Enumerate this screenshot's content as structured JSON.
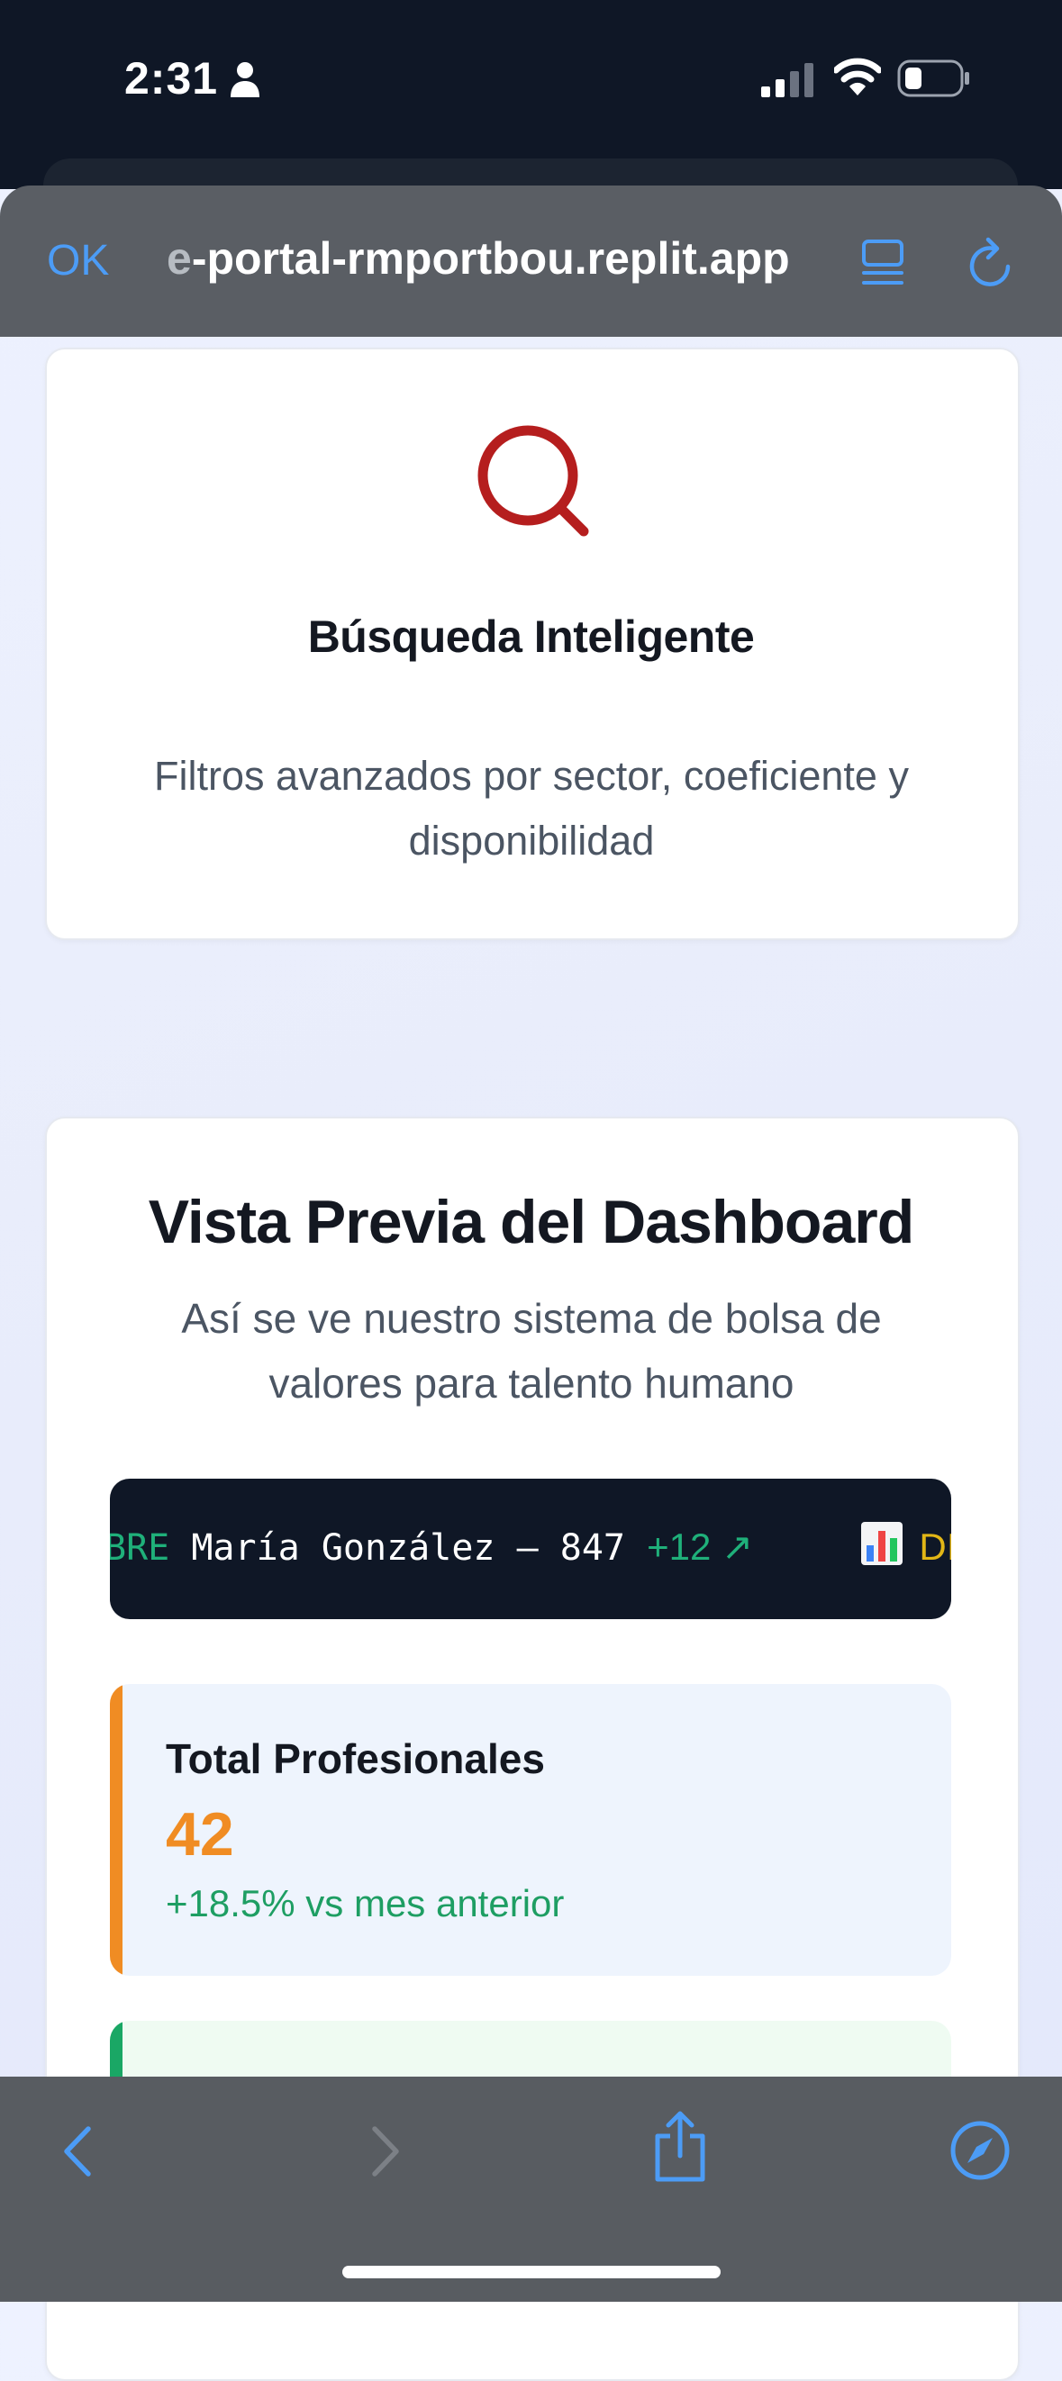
{
  "status_bar": {
    "time": "2:31"
  },
  "browser": {
    "done_label": "OK",
    "url_faded": "e",
    "url_main": "-portal-rmportbou.replit.app"
  },
  "feature": {
    "title": "Búsqueda Inteligente",
    "description": "Filtros avanzados por sector, coeficiente y disponibilidad",
    "icon": "search-icon",
    "icon_color": "#b51e1e"
  },
  "dashboard": {
    "title": "Vista Previa del Dashboard",
    "subtitle": "Así se ve nuestro sistema de bolsa de valores para talento humano",
    "ticker": {
      "prefix": "BRE",
      "entry": "María González – 847",
      "change": "+12 ↗",
      "next_tag": "DIS"
    },
    "stats": [
      {
        "label": "Total Profesionales",
        "value": "42",
        "change": "+18.5% vs mes anterior",
        "accent": "#f08c23"
      },
      {
        "accent": "#1aa765"
      }
    ]
  },
  "colors": {
    "accent_blue": "#4c9cf6",
    "positive": "#1e9e63",
    "ticker_bg": "#0f1726"
  }
}
